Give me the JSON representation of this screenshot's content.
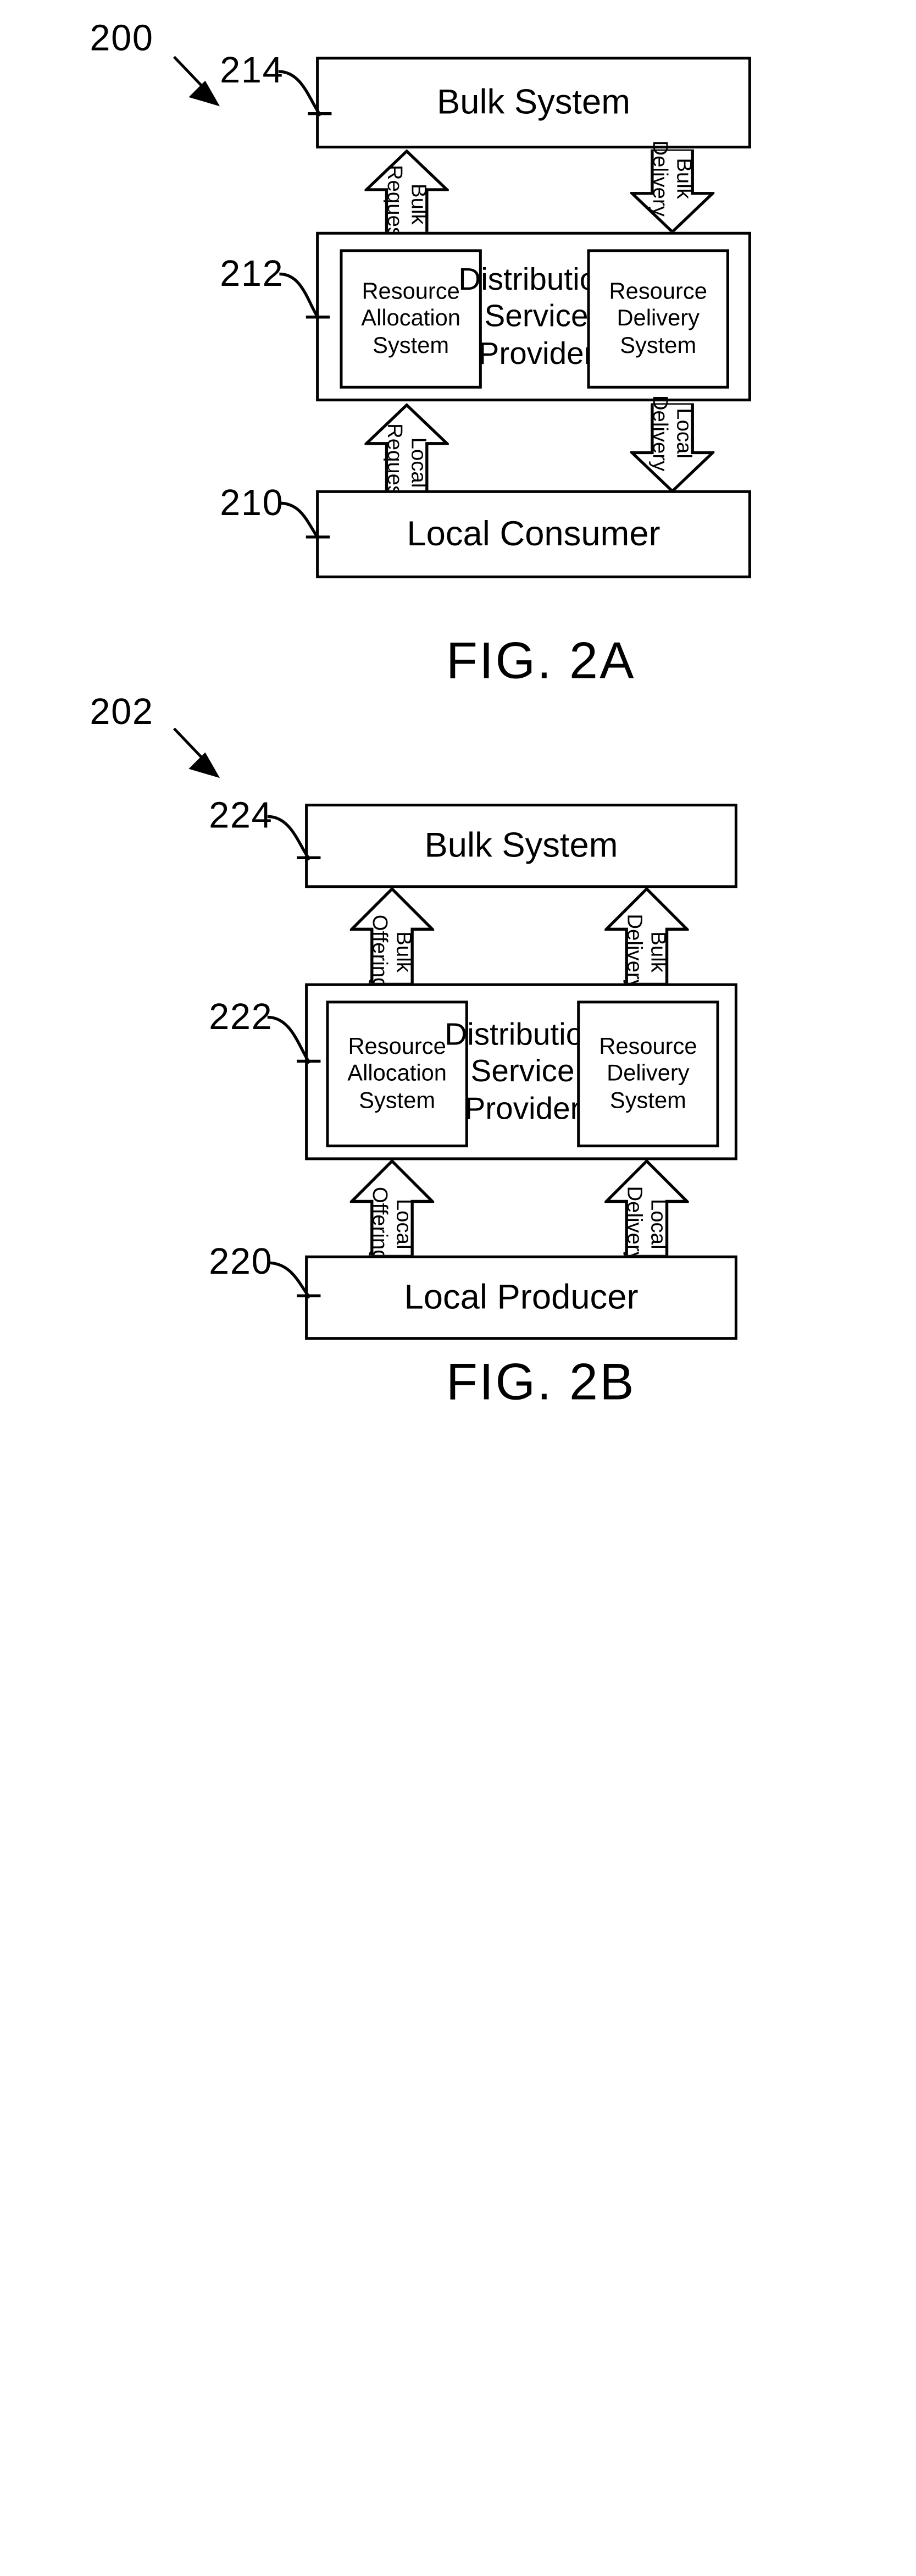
{
  "figures": [
    {
      "id": "fig-2a",
      "caption": "FIG. 2A",
      "diagram_ref": "200",
      "nodes": [
        {
          "ref": "214",
          "label": "Bulk System"
        },
        {
          "ref": "212",
          "label": "Distribution\nService\nProvider"
        },
        {
          "ref": "210",
          "label": "Local Consumer"
        }
      ],
      "subsystems": [
        {
          "label": "Resource\nAllocation\nSystem"
        },
        {
          "label": "Resource\nDelivery\nSystem"
        }
      ],
      "flows": [
        {
          "label": "Bulk\nRequest",
          "direction": "up"
        },
        {
          "label": "Bulk\nDelivery",
          "direction": "down"
        },
        {
          "label": "Local\nRequest",
          "direction": "up"
        },
        {
          "label": "Local\nDelivery",
          "direction": "down"
        }
      ]
    },
    {
      "id": "fig-2b",
      "caption": "FIG. 2B",
      "diagram_ref": "202",
      "nodes": [
        {
          "ref": "224",
          "label": "Bulk System"
        },
        {
          "ref": "222",
          "label": "Distribution\nService\nProvider"
        },
        {
          "ref": "220",
          "label": "Local Producer"
        }
      ],
      "subsystems": [
        {
          "label": "Resource\nAllocation\nSystem"
        },
        {
          "label": "Resource\nDelivery\nSystem"
        }
      ],
      "flows": [
        {
          "label": "Bulk\nOffering",
          "direction": "up"
        },
        {
          "label": "Bulk\nDelivery",
          "direction": "up"
        },
        {
          "label": "Local\nOffering",
          "direction": "up"
        },
        {
          "label": "Local\nDelivery",
          "direction": "up"
        }
      ]
    }
  ],
  "fig2a": {
    "ref_200": "200",
    "ref_214": "214",
    "ref_212": "212",
    "ref_210": "210",
    "bulk_system": "Bulk System",
    "dsp_line1": "Distribution",
    "dsp_line2": "Service",
    "dsp_line3": "Provider",
    "ras_line1": "Resource",
    "ras_line2": "Allocation",
    "ras_line3": "System",
    "rds_line1": "Resource",
    "rds_line2": "Delivery",
    "rds_line3": "System",
    "local_consumer": "Local Consumer",
    "arrow_bulk_request_l1": "Bulk",
    "arrow_bulk_request_l2": "Request",
    "arrow_bulk_delivery_l1": "Bulk",
    "arrow_bulk_delivery_l2": "Delivery",
    "arrow_local_request_l1": "Local",
    "arrow_local_request_l2": "Request",
    "arrow_local_delivery_l1": "Local",
    "arrow_local_delivery_l2": "Delivery",
    "caption": "FIG. 2A"
  },
  "fig2b": {
    "ref_202": "202",
    "ref_224": "224",
    "ref_222": "222",
    "ref_220": "220",
    "bulk_system": "Bulk System",
    "dsp_line1": "Distribution",
    "dsp_line2": "Service",
    "dsp_line3": "Provider",
    "ras_line1": "Resource",
    "ras_line2": "Allocation",
    "ras_line3": "System",
    "rds_line1": "Resource",
    "rds_line2": "Delivery",
    "rds_line3": "System",
    "local_producer": "Local Producer",
    "arrow_bulk_offering_l1": "Bulk",
    "arrow_bulk_offering_l2": "Offering",
    "arrow_bulk_delivery_l1": "Bulk",
    "arrow_bulk_delivery_l2": "Delivery",
    "arrow_local_offering_l1": "Local",
    "arrow_local_offering_l2": "Offering",
    "arrow_local_delivery_l1": "Local",
    "arrow_local_delivery_l2": "Delivery",
    "caption": "FIG. 2B"
  },
  "colors": {
    "line": "#000000",
    "background": "#ffffff"
  }
}
